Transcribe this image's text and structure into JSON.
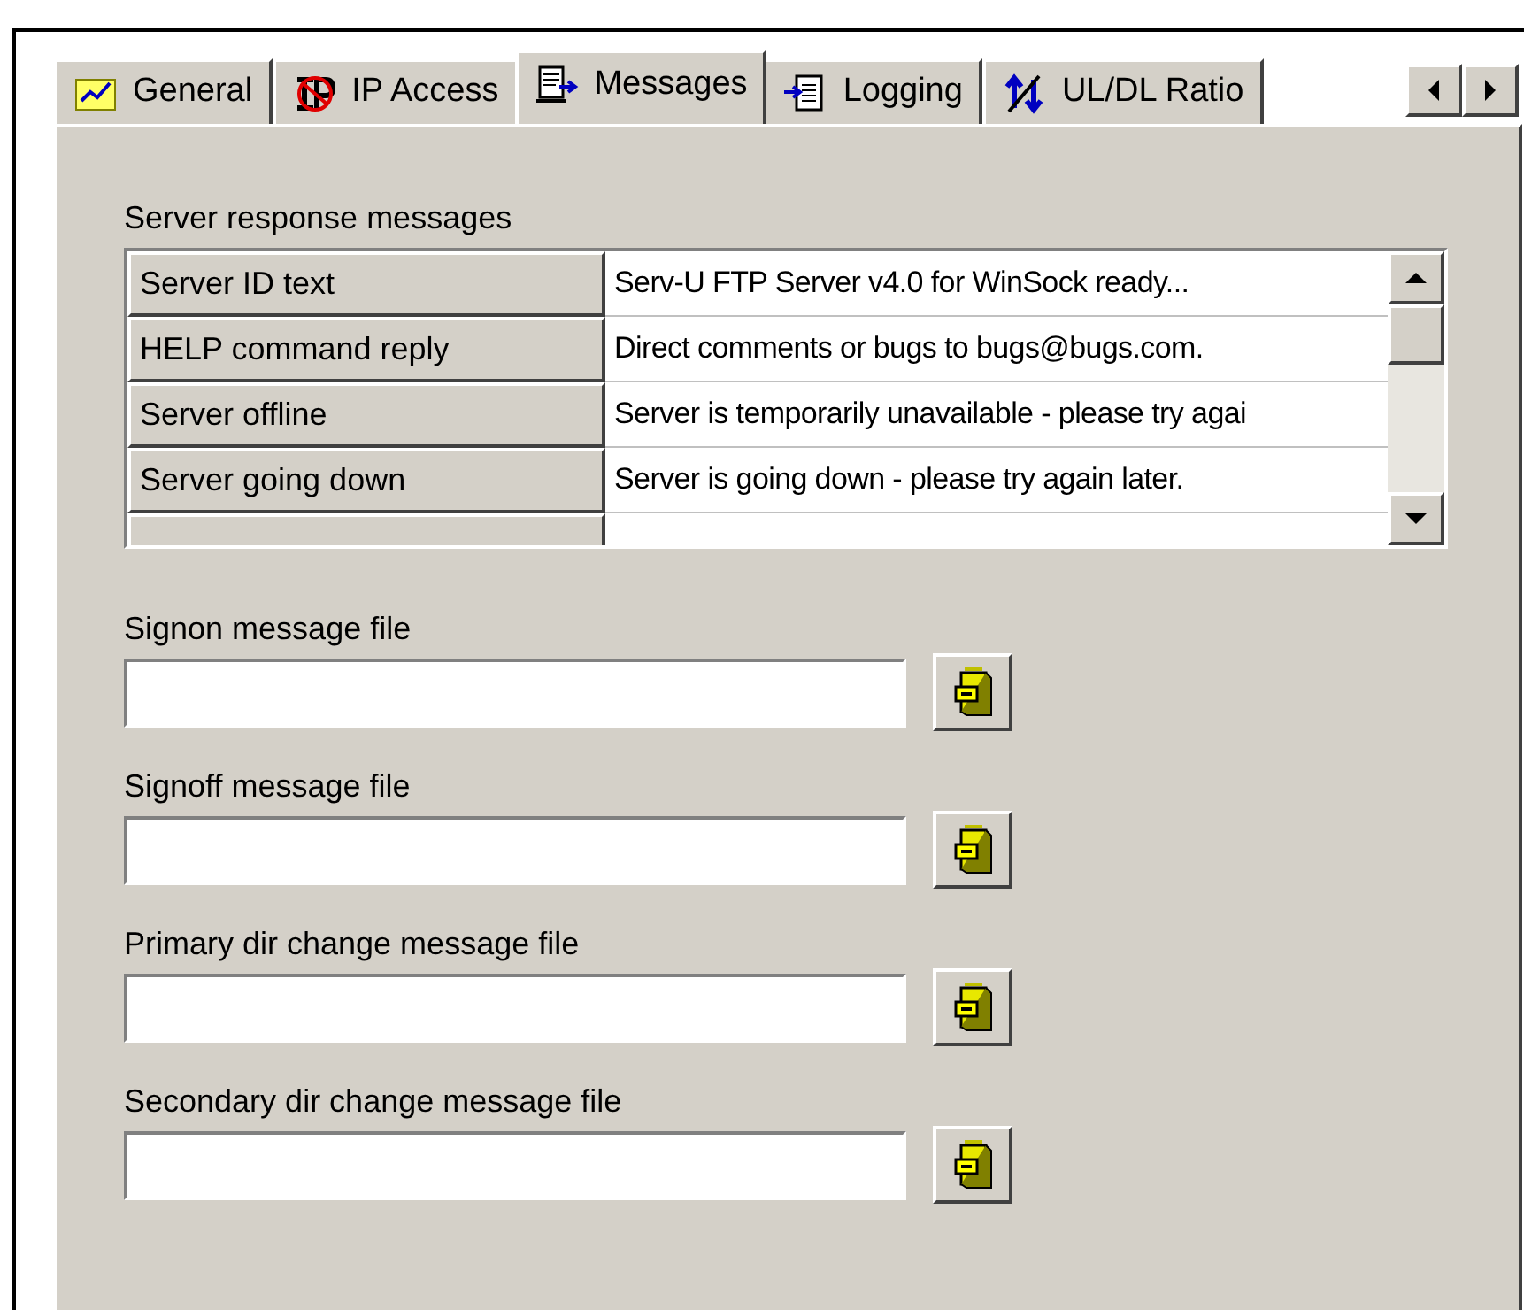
{
  "tabs": [
    {
      "label": "General",
      "selected": false
    },
    {
      "label": "IP Access",
      "selected": false
    },
    {
      "label": "Messages",
      "selected": true
    },
    {
      "label": "Logging",
      "selected": false
    },
    {
      "label": "UL/DL Ratio",
      "selected": false
    }
  ],
  "messages": {
    "title": "Server response messages",
    "rows": [
      {
        "name": "Server ID text",
        "value": "Serv-U FTP Server v4.0 for WinSock ready..."
      },
      {
        "name": "HELP command reply",
        "value": "Direct comments or bugs to bugs@bugs.com."
      },
      {
        "name": "Server offline",
        "value": "Server is temporarily unavailable - please try agai"
      },
      {
        "name": "Server going down",
        "value": "Server is going down - please try again later."
      }
    ]
  },
  "file_fields": [
    {
      "label": "Signon message file"
    },
    {
      "label": "Signoff message file"
    },
    {
      "label": "Primary dir change message file"
    },
    {
      "label": "Secondary dir change message file"
    }
  ]
}
